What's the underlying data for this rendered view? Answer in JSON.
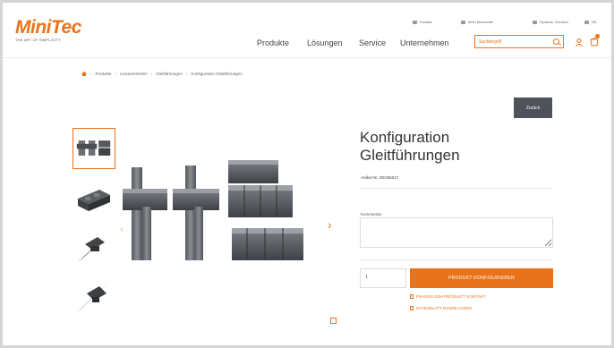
{
  "header": {
    "logo": "MiniTec",
    "tagline": "THE ART OF SIMPLICITY",
    "util": [
      {
        "label": "Kontakt",
        "icon": "phone-icon"
      },
      {
        "label": "Mein Merkzettel",
        "icon": "bookmark-icon"
      },
      {
        "label": "Sprache: Deutsch",
        "icon": "globe-icon"
      },
      {
        "label": "DE",
        "icon": "flag-icon"
      }
    ],
    "nav": [
      "Produkte",
      "Lösungen",
      "Service",
      "Unternehmen"
    ],
    "search_placeholder": "Suchbegriff"
  },
  "breadcrumb": [
    "Produkte",
    "Lineareinheiten",
    "Gleitführungen",
    "Konfiguration Gleitführungen"
  ],
  "product": {
    "back_label": "Zurück",
    "title_line1": "Konfiguration",
    "title_line2": "Gleitführungen",
    "article": "Artikel-Nr. DE305017",
    "comment_label": "Kommentar",
    "quantity": "1",
    "configure_label": "PRODUKT KONFIGURIEREN",
    "link1": "FRAGEN ZUM PRODUKT? KONTAKT",
    "link2": "DATENBLATT DOWNLOADEN"
  },
  "colors": {
    "accent": "#e8731a",
    "dark": "#4d5358"
  }
}
